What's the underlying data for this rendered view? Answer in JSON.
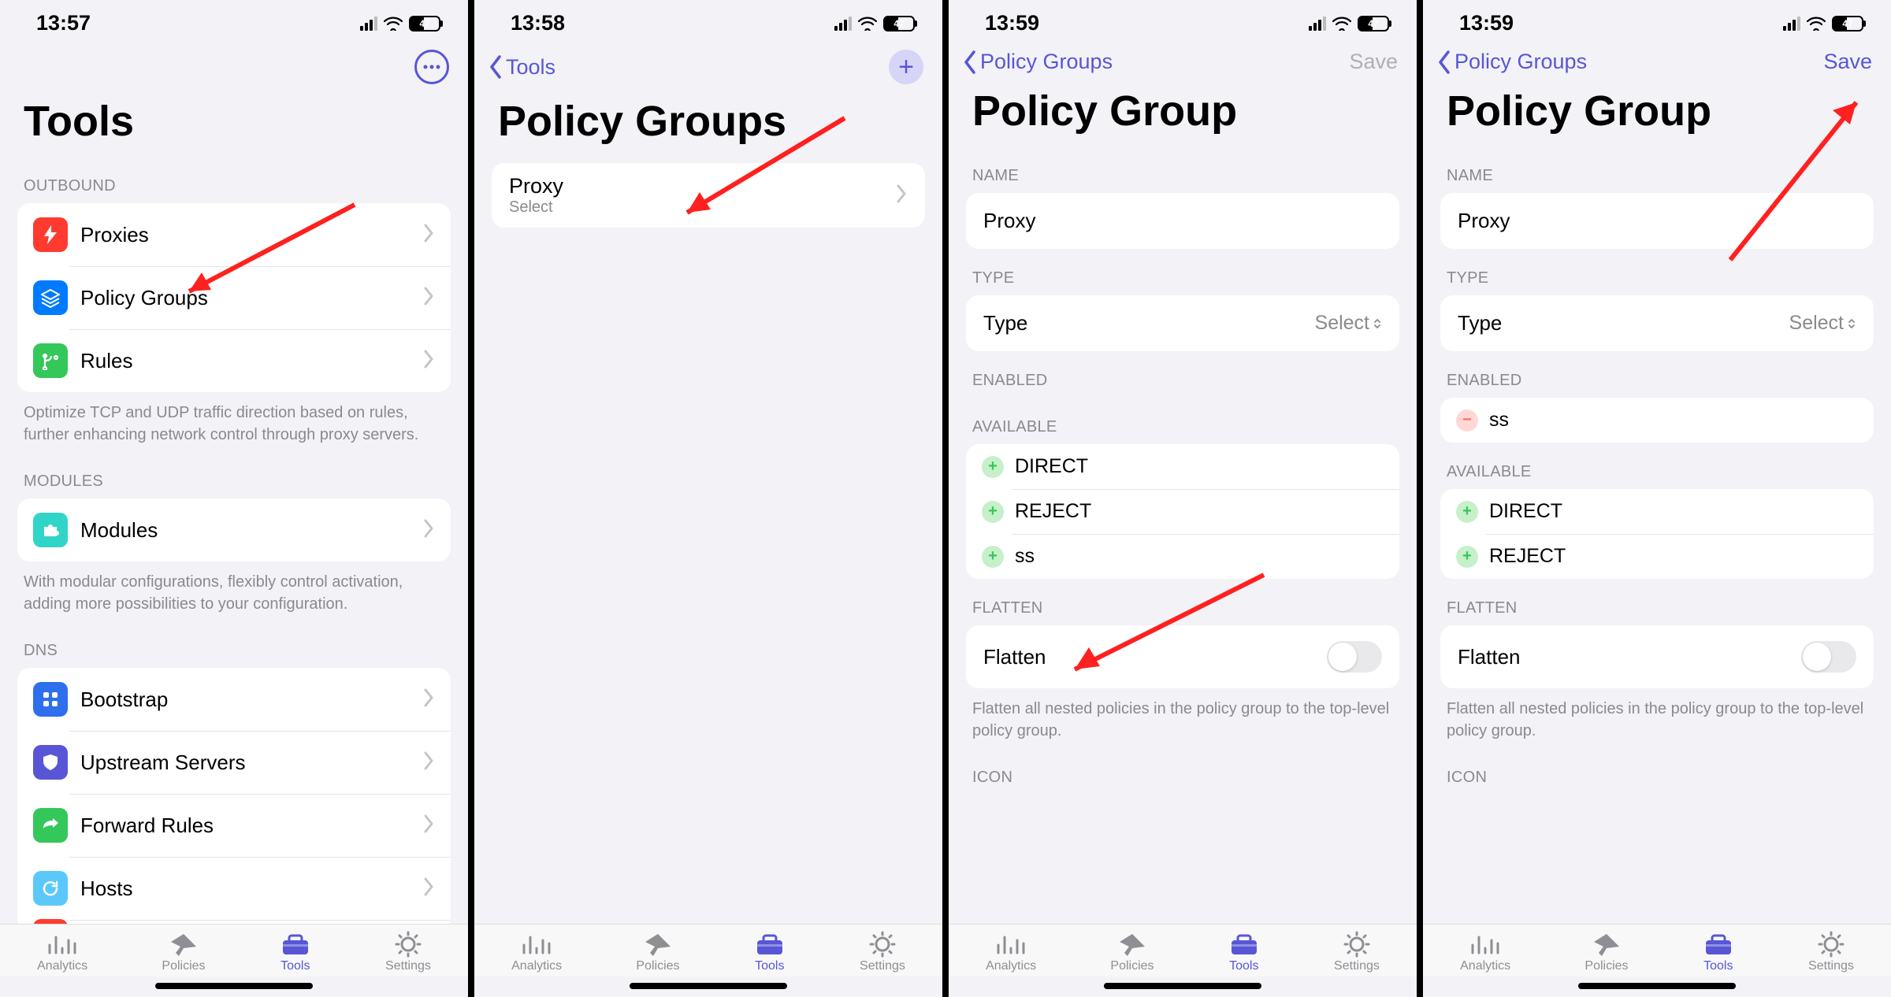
{
  "battery": "47",
  "tabs": {
    "analytics": "Analytics",
    "policies": "Policies",
    "tools": "Tools",
    "settings": "Settings"
  },
  "screen1": {
    "time": "13:57",
    "title": "Tools",
    "sections": {
      "outbound": {
        "label": "OUTBOUND",
        "items": [
          "Proxies",
          "Policy Groups",
          "Rules"
        ],
        "note": "Optimize TCP and UDP traffic direction based on rules, further enhancing network control through proxy servers."
      },
      "modules": {
        "label": "MODULES",
        "items": [
          "Modules"
        ],
        "note": "With modular configurations, flexibly control activation, adding more possibilities to your configuration."
      },
      "dns": {
        "label": "DNS",
        "items": [
          "Bootstrap",
          "Upstream Servers",
          "Forward Rules",
          "Hosts"
        ]
      }
    }
  },
  "screen2": {
    "time": "13:58",
    "back": "Tools",
    "title": "Policy Groups",
    "item": {
      "name": "Proxy",
      "sub": "Select"
    }
  },
  "screen3": {
    "time": "13:59",
    "back": "Policy Groups",
    "save": "Save",
    "title": "Policy Group",
    "name_label": "NAME",
    "name_value": "Proxy",
    "type_label": "TYPE",
    "type_value": "Type",
    "type_select": "Select",
    "enabled_label": "ENABLED",
    "available_label": "AVAILABLE",
    "available": [
      "DIRECT",
      "REJECT",
      "ss"
    ],
    "flatten_label": "FLATTEN",
    "flatten_value": "Flatten",
    "flatten_note": "Flatten all nested policies in the policy group to the top-level policy group.",
    "icon_label": "ICON"
  },
  "screen4": {
    "time": "13:59",
    "back": "Policy Groups",
    "save": "Save",
    "title": "Policy Group",
    "name_label": "NAME",
    "name_value": "Proxy",
    "type_label": "TYPE",
    "type_value": "Type",
    "type_select": "Select",
    "enabled_label": "ENABLED",
    "enabled": [
      "ss"
    ],
    "available_label": "AVAILABLE",
    "available": [
      "DIRECT",
      "REJECT"
    ],
    "flatten_label": "FLATTEN",
    "flatten_value": "Flatten",
    "flatten_note": "Flatten all nested policies in the policy group to the top-level policy group.",
    "icon_label": "ICON"
  }
}
